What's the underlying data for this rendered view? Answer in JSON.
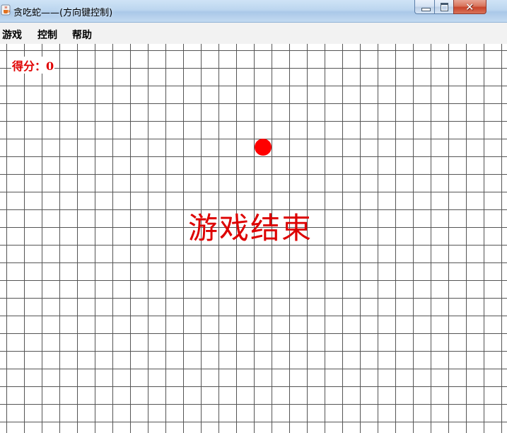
{
  "window": {
    "title": "贪吃蛇——(方向键控制)",
    "app_icon": "java-coffee-cup-icon",
    "buttons": {
      "minimize_icon": "minimize-icon",
      "maximize_icon": "maximize-icon",
      "close_icon": "close-icon",
      "close_glyph": "✕"
    }
  },
  "menu": {
    "items": [
      {
        "label": "游戏"
      },
      {
        "label": "控制"
      },
      {
        "label": "帮助"
      }
    ]
  },
  "game": {
    "score_text": "得分：0",
    "status_text": "游戏结束",
    "food_color": "#ff0000",
    "text_color": "#dd0000",
    "grid_color": "#555555"
  }
}
